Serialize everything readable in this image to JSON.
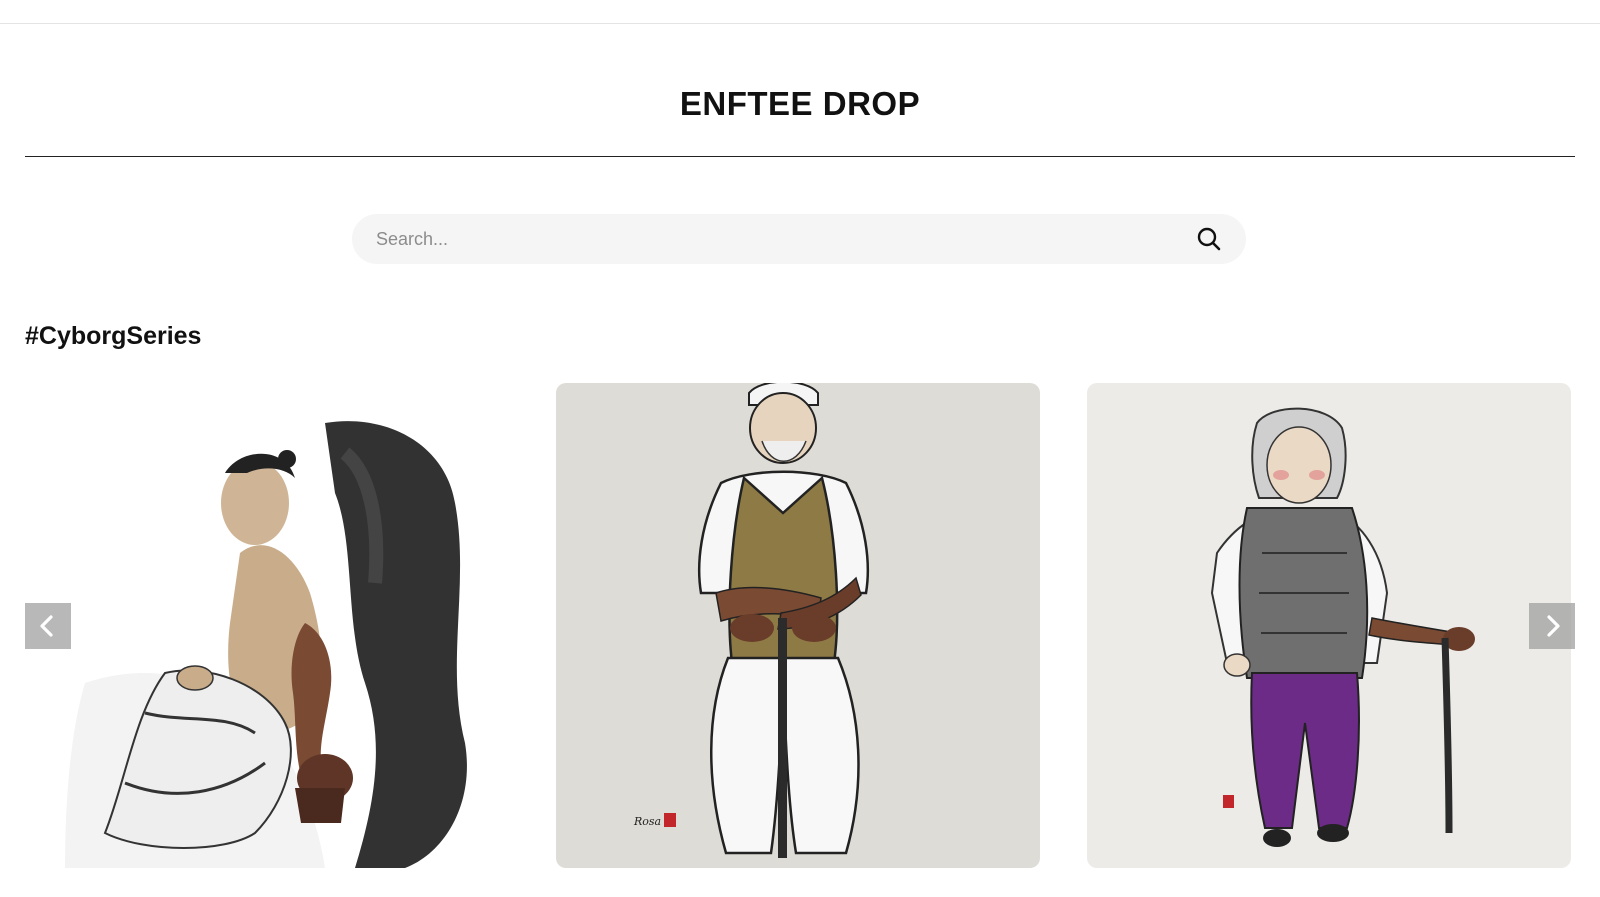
{
  "site": {
    "title": "ENFTEE DROP"
  },
  "search": {
    "placeholder": "Search..."
  },
  "section": {
    "heading": "#CyborgSeries"
  },
  "carousel": {
    "items": [
      {
        "name": "cyborg-artwork-seated-man"
      },
      {
        "name": "cyborg-artwork-standing-man-with-cane"
      },
      {
        "name": "cyborg-artwork-woman-with-cane"
      }
    ],
    "prev_icon": "chevron-left-icon",
    "next_icon": "chevron-right-icon"
  },
  "artwork": {
    "signature": "Rosa"
  },
  "colors": {
    "card1_bg": "#ffffff",
    "card2_bg": "#dedcd6",
    "card3_bg": "#ecebe7",
    "vest_olive": "#8e7a45",
    "vest_gray": "#6f6f6f",
    "pants_purple": "#6b2b86",
    "bronze": "#7a4a33"
  }
}
